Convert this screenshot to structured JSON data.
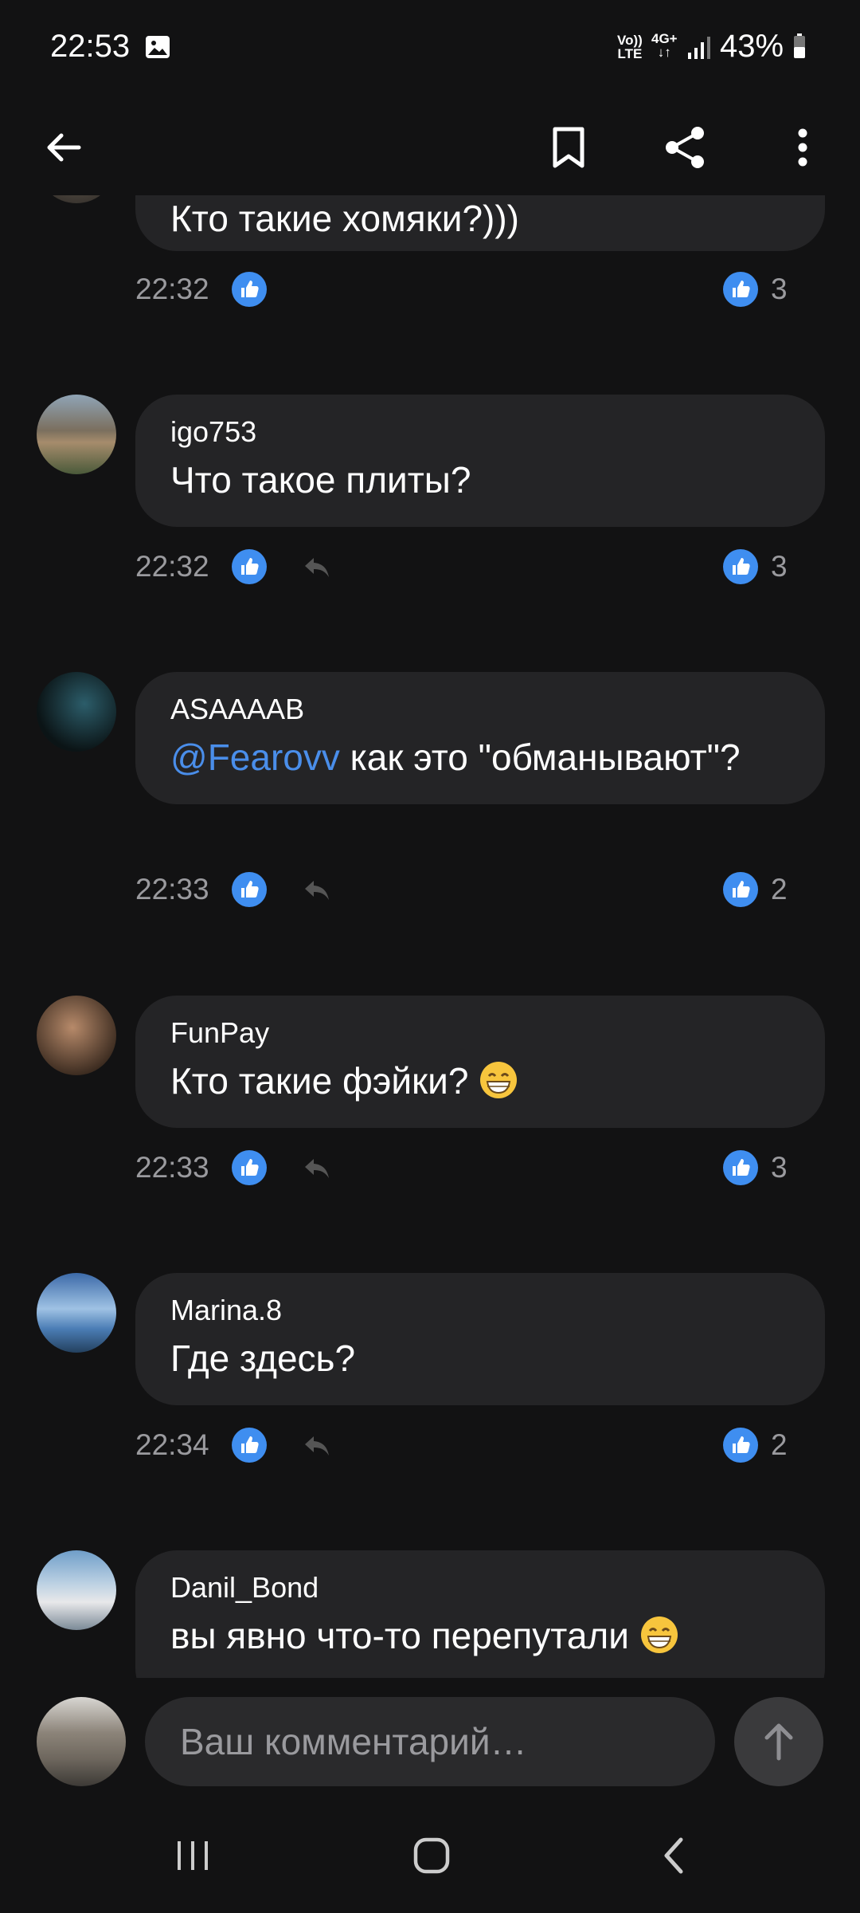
{
  "status_bar": {
    "time": "22:53",
    "network_1_top": "Vo))",
    "network_1_bottom": "LTE",
    "network_2_top": "4G+",
    "network_2_bottom": "↓↑",
    "battery": "43%"
  },
  "app_bar": {
    "icons": [
      "back-arrow-icon",
      "bookmark-icon",
      "share-icon",
      "more-vert-icon"
    ]
  },
  "comments": [
    {
      "author": "",
      "text": "Кто такие хомяки?)))",
      "time": "22:32",
      "likes": "3"
    },
    {
      "author": "igo753",
      "text": "Что такое плиты?",
      "time": "22:32",
      "likes": "3"
    },
    {
      "author": "ASAAAAB",
      "mention": "@Fearovv",
      "text": " как это \"обманывают\"?",
      "time": "22:33",
      "likes": "2"
    },
    {
      "author": "FunPay",
      "text": "Кто такие фэйки? ",
      "time": "22:33",
      "likes": "3"
    },
    {
      "author": "Marina.8",
      "text": "Где здесь?",
      "time": "22:34",
      "likes": "2"
    },
    {
      "author": "Danil_Bond",
      "text": "вы явно что-то перепутали "
    }
  ],
  "composer": {
    "placeholder": "Ваш комментарий…"
  },
  "colors": {
    "background": "#121213",
    "bubble": "#242426",
    "accent": "#4a8eea",
    "like_blue": "#3f8ef0"
  }
}
